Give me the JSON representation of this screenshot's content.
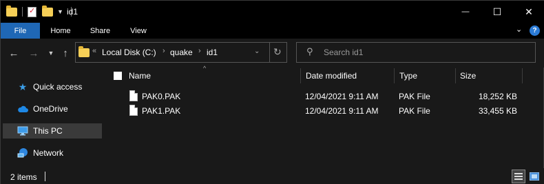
{
  "window": {
    "title": "id1",
    "controls": {
      "minimize": "—",
      "maximize": "☐",
      "close": "✕"
    }
  },
  "ribbon": {
    "tabs": [
      "File",
      "Home",
      "Share",
      "View"
    ],
    "expand_icon": "chevron-down-icon",
    "help_icon": "help-icon",
    "accent": "#1f67b5"
  },
  "address": {
    "breadcrumbs": [
      "Local Disk (C:)",
      "quake",
      "id1"
    ],
    "overflow": "«",
    "separator": "›",
    "search_placeholder": "Search id1"
  },
  "nav_pane": {
    "items": [
      {
        "label": "Quick access",
        "icon": "star-icon"
      },
      {
        "label": "OneDrive",
        "icon": "cloud-icon"
      },
      {
        "label": "This PC",
        "icon": "computer-icon",
        "selected": true
      },
      {
        "label": "Network",
        "icon": "network-icon"
      }
    ]
  },
  "columns": [
    "Name",
    "Date modified",
    "Type",
    "Size"
  ],
  "files": [
    {
      "name": "PAK0.PAK",
      "date": "12/04/2021 9:11 AM",
      "type": "PAK File",
      "size": "18,252 KB"
    },
    {
      "name": "PAK1.PAK",
      "date": "12/04/2021 9:11 AM",
      "type": "PAK File",
      "size": "33,455 KB"
    }
  ],
  "status": {
    "item_count": "2 items"
  }
}
